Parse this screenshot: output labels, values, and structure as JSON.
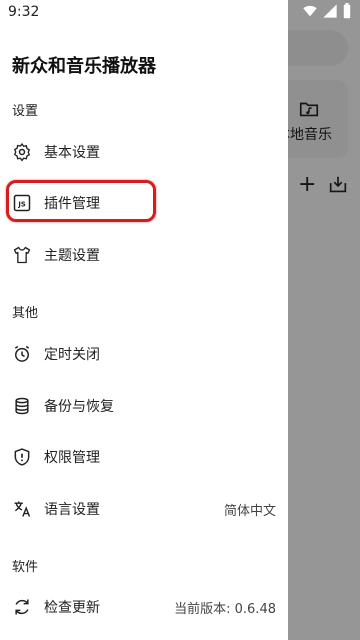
{
  "status_bar": {
    "time": "9:32"
  },
  "background": {
    "card_label": "本地音乐",
    "plus_symbol": "+"
  },
  "drawer": {
    "app_title": "新众和音乐播放器",
    "sections": {
      "settings": "设置",
      "other": "其他",
      "software": "软件"
    },
    "items": {
      "basic_settings": "基本设置",
      "plugin_management": "插件管理",
      "theme_settings": "主题设置",
      "timer_close": "定时关闭",
      "backup_restore": "备份与恢复",
      "permission_management": "权限管理",
      "language_settings": "语言设置",
      "language_value": "简体中文",
      "check_update": "检查更新",
      "current_version": "当前版本: 0.6.48"
    }
  },
  "colors": {
    "highlight": "#d61c1c",
    "scrim": "rgba(0,0,0,0.38)"
  }
}
